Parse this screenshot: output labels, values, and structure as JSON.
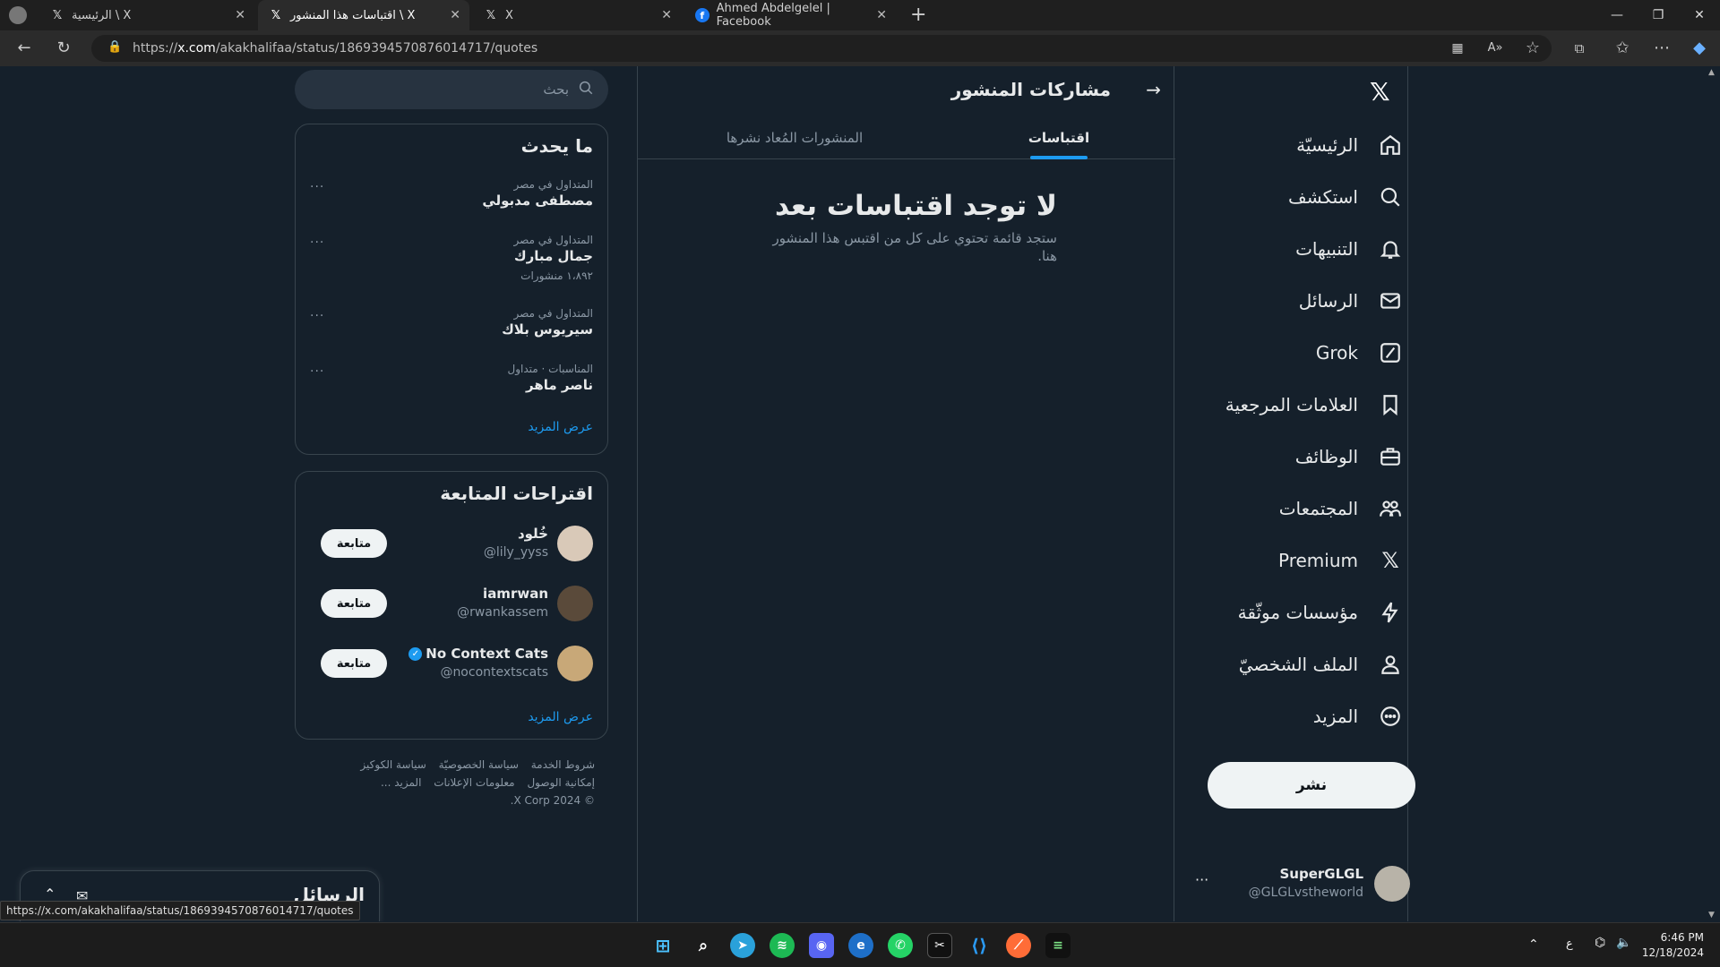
{
  "browser": {
    "tabs": [
      {
        "title": "الرئيسية \\ X",
        "icon": "x-logo-icon"
      },
      {
        "title": "اقتباسات هذا المنشور \\ X",
        "icon": "x-logo-icon",
        "active": true
      },
      {
        "title": "X",
        "icon": "x-logo-icon"
      },
      {
        "title": "Ahmed Abdelgelel | Facebook",
        "icon": "facebook-icon"
      }
    ],
    "url_prefix": "https://",
    "url_domain": "x.com",
    "url_path": "/akakhalifaa/status/1869394570876014717/quotes"
  },
  "sidenav": {
    "items": [
      {
        "label": "الرئيسيّة",
        "icon": "home-icon"
      },
      {
        "label": "استكشف",
        "icon": "search-icon"
      },
      {
        "label": "التنبيهات",
        "icon": "bell-icon"
      },
      {
        "label": "الرسائل",
        "icon": "mail-icon"
      },
      {
        "label": "Grok",
        "icon": "grok-icon"
      },
      {
        "label": "العلامات المرجعية",
        "icon": "bookmark-icon"
      },
      {
        "label": "الوظائف",
        "icon": "briefcase-icon"
      },
      {
        "label": "المجتمعات",
        "icon": "communities-icon"
      },
      {
        "label": "Premium",
        "icon": "x-logo-icon"
      },
      {
        "label": "مؤسسات موثّقة",
        "icon": "lightning-icon"
      },
      {
        "label": "الملف الشخصيّ",
        "icon": "profile-icon"
      },
      {
        "label": "المزيد",
        "icon": "more-circle-icon"
      }
    ],
    "post_label": "نشر",
    "account": {
      "name": "SuperGLGL",
      "handle": "@GLGLvstheworld"
    }
  },
  "main": {
    "title": "مشاركات المنشور",
    "tabs": [
      {
        "label": "اقتباسات",
        "active": true
      },
      {
        "label": "المنشورات المُعاد نشرها",
        "active": false
      }
    ],
    "empty_title": "لا توجد اقتباسات بعد",
    "empty_text": "ستجد قائمة تحتوي على كل من اقتبس هذا المنشور هنا."
  },
  "right": {
    "search_placeholder": "بحث",
    "whats_happening": {
      "title": "ما يحدث",
      "trends": [
        {
          "meta": "المتداول في مصر",
          "name": "مصطفى مدبولي",
          "count": ""
        },
        {
          "meta": "المتداول في مصر",
          "name": "جمال مبارك",
          "count": "١،٨٩٢ منشورات"
        },
        {
          "meta": "المتداول في مصر",
          "name": "سيريوس بلاك",
          "count": ""
        },
        {
          "meta": "المناسبات · متداول",
          "name": "ناصر ماهر",
          "count": ""
        }
      ],
      "more": "عرض المزيد"
    },
    "who_to_follow": {
      "title": "اقتراحات المتابعة",
      "users": [
        {
          "name": "خُلود",
          "handle": "@lily_yyss",
          "verified": false,
          "button": "متابعة"
        },
        {
          "name": "iamrwan",
          "handle": "@rwankassem",
          "verified": false,
          "button": "متابعة"
        },
        {
          "name": "No Context Cats",
          "handle": "@nocontextscats",
          "verified": true,
          "button": "متابعة"
        }
      ],
      "more": "عرض المزيد"
    },
    "footer": {
      "line1": [
        "شروط الخدمة",
        "سياسة الخصوصيّة",
        "سياسة الكوكيز"
      ],
      "line2": [
        "إمكانية الوصول",
        "معلومات الإعلانات",
        "المزيد ..."
      ],
      "copyright": "© 2024 X Corp."
    },
    "messages_drawer": "الرسائل"
  },
  "status_url": "https://x.com/akakhalifaa/status/1869394570876014717/quotes",
  "taskbar": {
    "time": "6:46 PM",
    "date": "12/18/2024",
    "lang": "ع"
  },
  "colors": {
    "accent": "#1d9bf0",
    "background": "#15202b",
    "border": "#38444d"
  }
}
